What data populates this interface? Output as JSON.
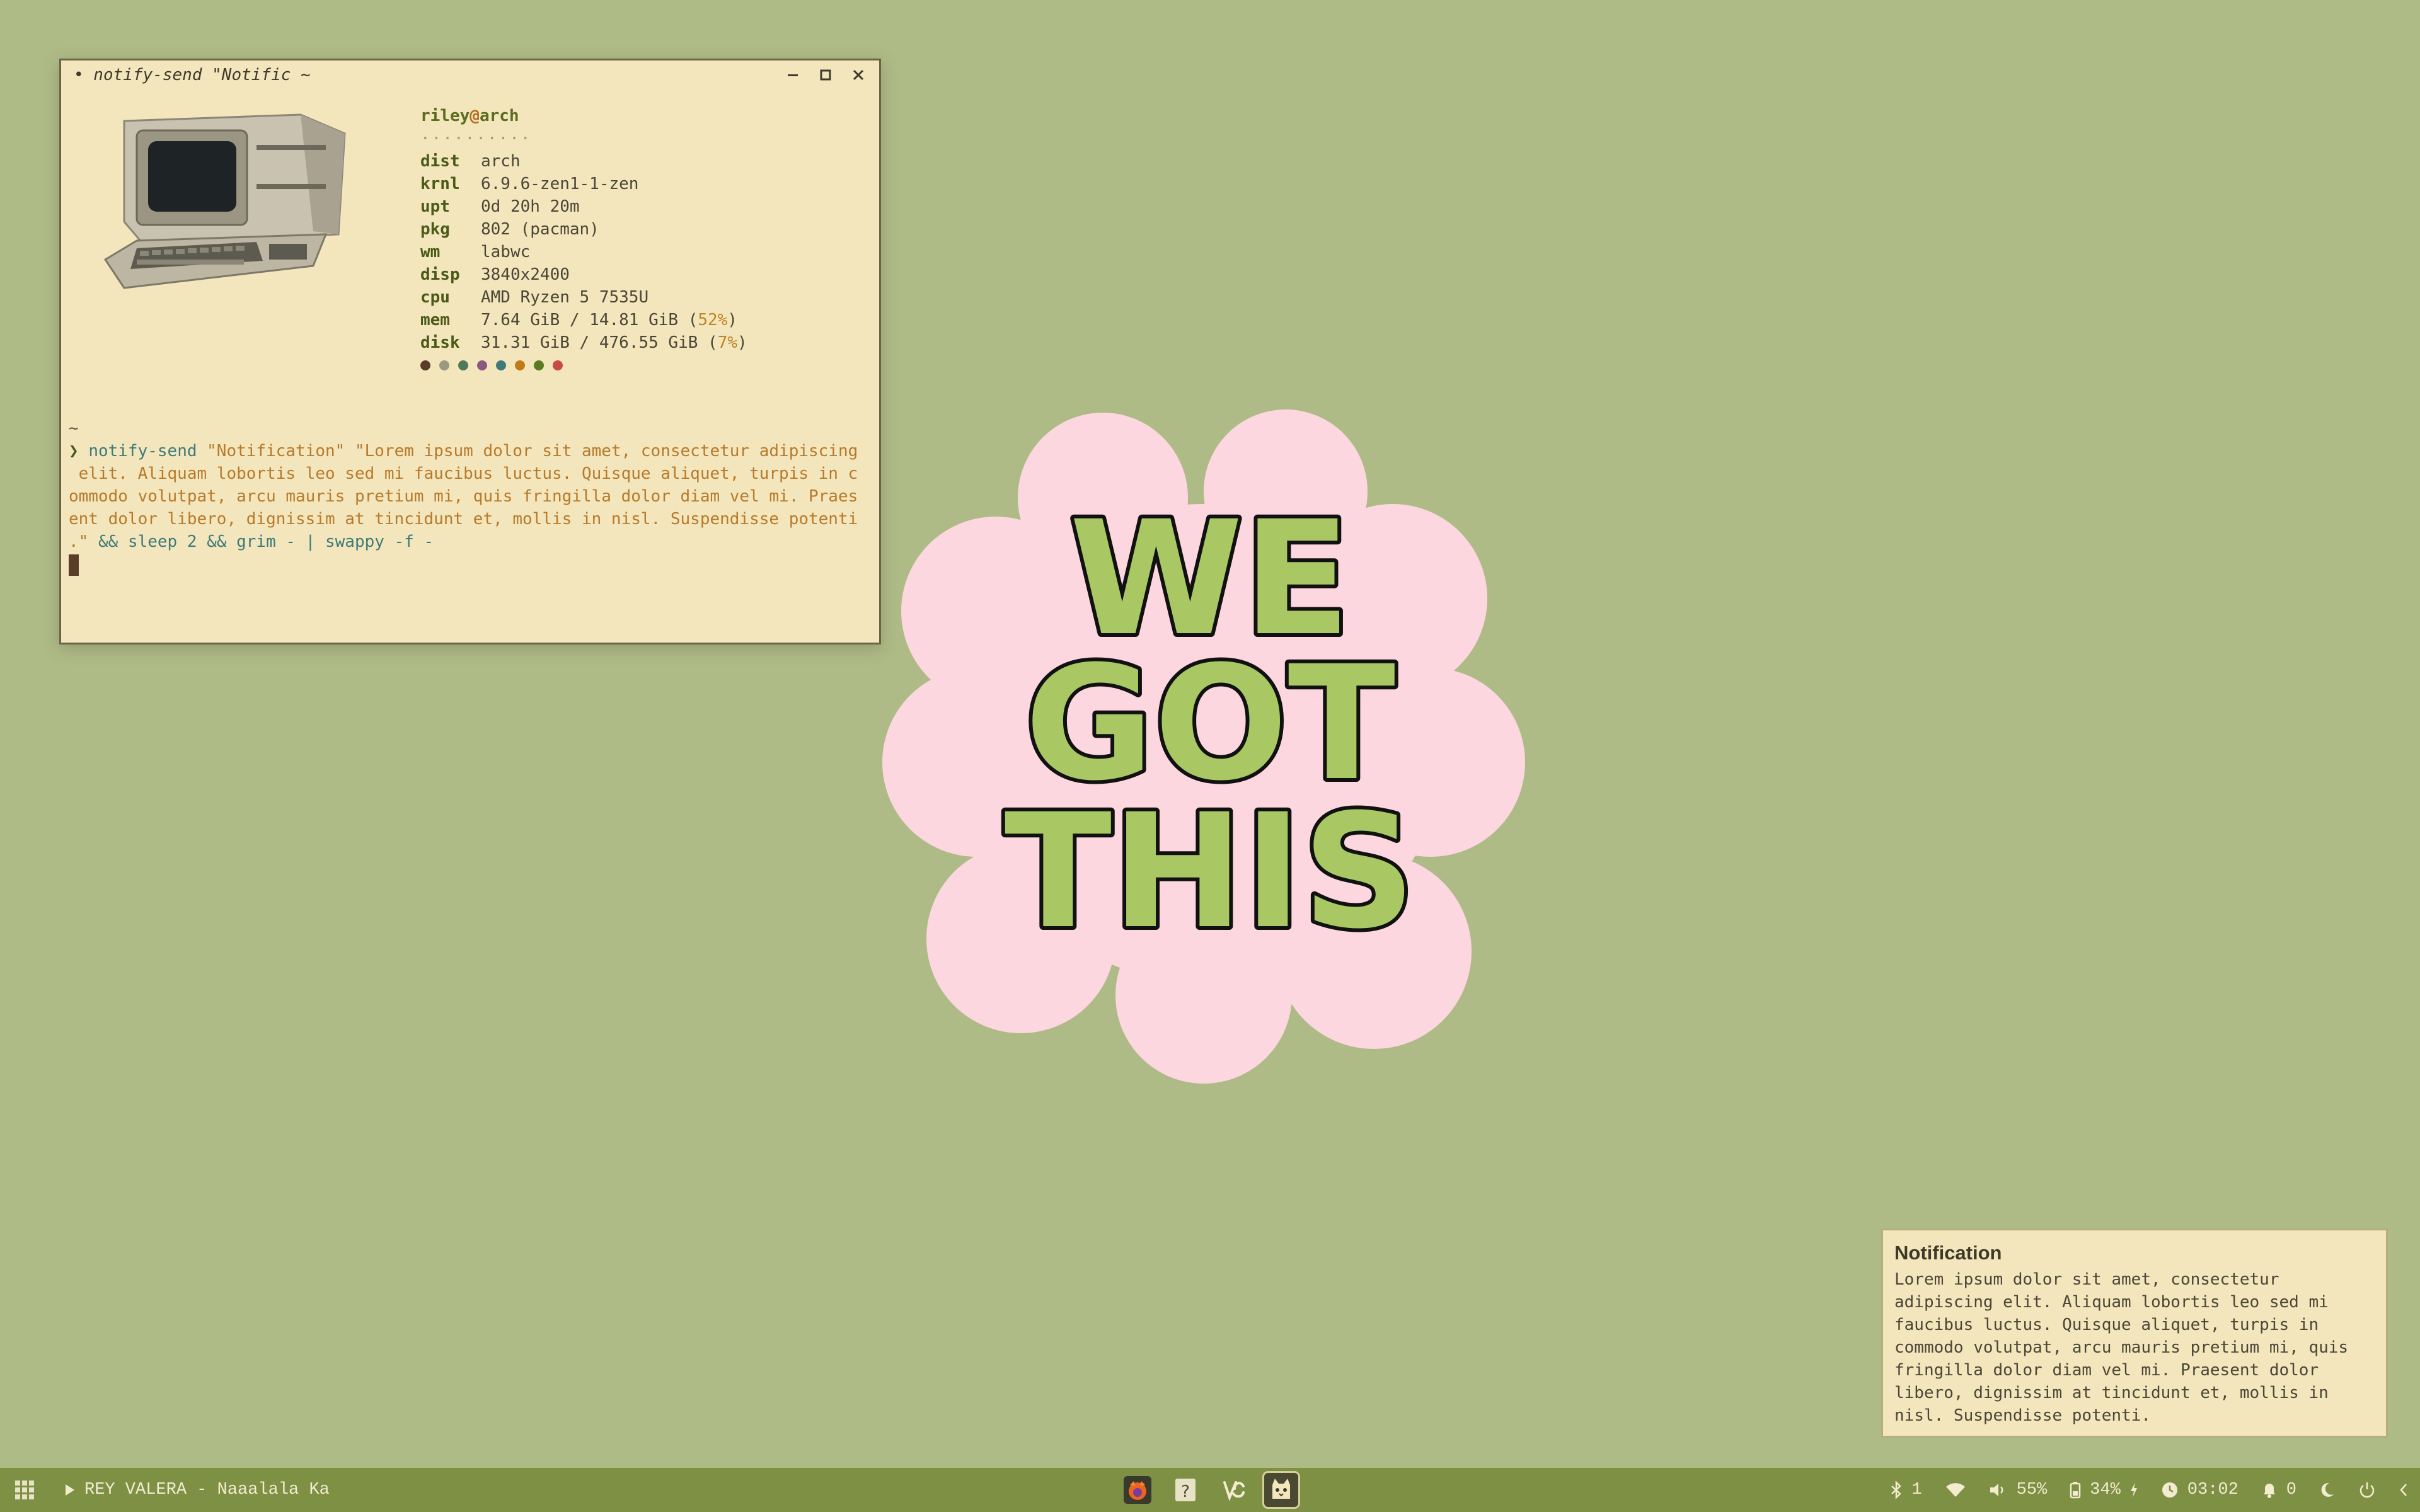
{
  "terminal": {
    "title": "• notify-send \"Notific ~",
    "user": "riley",
    "at": "@",
    "host": "arch",
    "separator": "··········",
    "fetch": [
      {
        "key": "dist",
        "value": "arch"
      },
      {
        "key": "krnl",
        "value": "6.9.6-zen1-1-zen"
      },
      {
        "key": "upt",
        "value": "0d 20h 20m"
      },
      {
        "key": "pkg",
        "value": "802 (pacman)"
      },
      {
        "key": "wm",
        "value": "labwc"
      },
      {
        "key": "disp",
        "value": "3840x2400"
      },
      {
        "key": "cpu",
        "value": "AMD Ryzen 5 7535U"
      }
    ],
    "mem": {
      "key": "mem",
      "value": "7.64 GiB / 14.81 GiB (",
      "pct": "52%",
      "close": ")"
    },
    "disk": {
      "key": "disk",
      "value": "31.31 GiB / 476.55 GiB (",
      "pct": "7%",
      "close": ")"
    },
    "palette": [
      "#5a3f28",
      "#9b9a80",
      "#4f7a58",
      "#8a5a7e",
      "#3f7a78",
      "#c07a18",
      "#5b7a22",
      "#c84a4a"
    ],
    "cwd": "~",
    "prompt_symbol": "❯",
    "command": "notify-send",
    "cmd_lines": [
      "\"Notification\" \"Lorem ipsum dolor sit amet, consectetur adipiscing",
      " elit. Aliquam lobortis leo sed mi faucibus luctus. Quisque aliquet, turpis in c",
      "ommodo volutpat, arcu mauris pretium mi, quis fringilla dolor diam vel mi. Praes",
      "ent dolor libero, dignissim at tincidunt et, mollis in nisl. Suspendisse potenti",
      ".\""
    ],
    "cmd_tail": " && sleep 2 && grim - | swappy -f -"
  },
  "sticker": {
    "lines": [
      "WE",
      "GOT",
      "THIS"
    ],
    "bg_color": "#fdd7df",
    "letter_color": "#a9c864"
  },
  "notification": {
    "title": "Notification",
    "body_lines": [
      "Lorem ipsum dolor sit amet, consectetur",
      "adipiscing elit. Aliquam lobortis leo sed mi",
      "faucibus luctus. Quisque aliquet, turpis in",
      "commodo volutpat, arcu mauris pretium mi, quis",
      "fringilla dolor diam vel mi. Praesent dolor",
      "libero, dignissim at tincidunt et, mollis in",
      "nisl. Suspendisse potenti."
    ]
  },
  "taskbar": {
    "media_title": "REY VALERA - Naaalala Ka",
    "apps": [
      "firefox-icon",
      "help-icon",
      "vscodium-icon",
      "terminal-cat-icon"
    ],
    "bluetooth_count": "1",
    "volume": "55%",
    "battery": "34%",
    "time": "03:02",
    "notifications": "0"
  }
}
